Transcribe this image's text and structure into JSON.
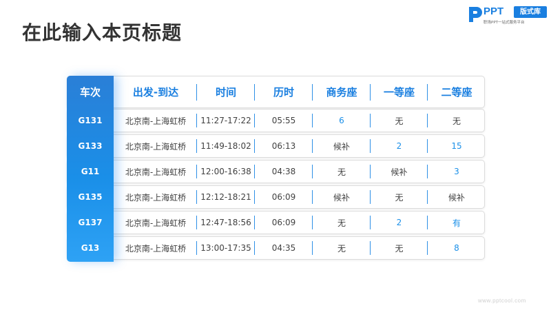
{
  "page": {
    "title": "在此输入本页标题",
    "footer_url": "www.pptcool.com"
  },
  "logo": {
    "ppt": "PPT",
    "badge": "版式库",
    "subtitle": "职场PPT一站式服务平台"
  },
  "table": {
    "headers": [
      "车次",
      "出发-到达",
      "时间",
      "历时",
      "商务座",
      "一等座",
      "二等座"
    ],
    "rows": [
      {
        "train": "G131",
        "route": "北京南-上海虹桥",
        "time": "11:27-17:22",
        "duration": "05:55",
        "business": "6",
        "first": "无",
        "second": "无"
      },
      {
        "train": "G133",
        "route": "北京南-上海虹桥",
        "time": "11:49-18:02",
        "duration": "06:13",
        "business": "候补",
        "first": "2",
        "second": "15"
      },
      {
        "train": "G11",
        "route": "北京南-上海虹桥",
        "time": "12:00-16:38",
        "duration": "04:38",
        "business": "无",
        "first": "候补",
        "second": "3"
      },
      {
        "train": "G135",
        "route": "北京南-上海虹桥",
        "time": "12:12-18:21",
        "duration": "06:09",
        "business": "候补",
        "first": "无",
        "second": "候补"
      },
      {
        "train": "G137",
        "route": "北京南-上海虹桥",
        "time": "12:47-18:56",
        "duration": "06:09",
        "business": "无",
        "first": "2",
        "second": "有"
      },
      {
        "train": "G13",
        "route": "北京南-上海虹桥",
        "time": "13:00-17:35",
        "duration": "04:35",
        "business": "无",
        "first": "无",
        "second": "8"
      }
    ]
  },
  "colors": {
    "accent": "#1a7fe0",
    "band_top": "#2a7fd7",
    "band_bottom": "#2ea2f5",
    "available_text": "#1a8fe8",
    "default_text": "#404040"
  }
}
